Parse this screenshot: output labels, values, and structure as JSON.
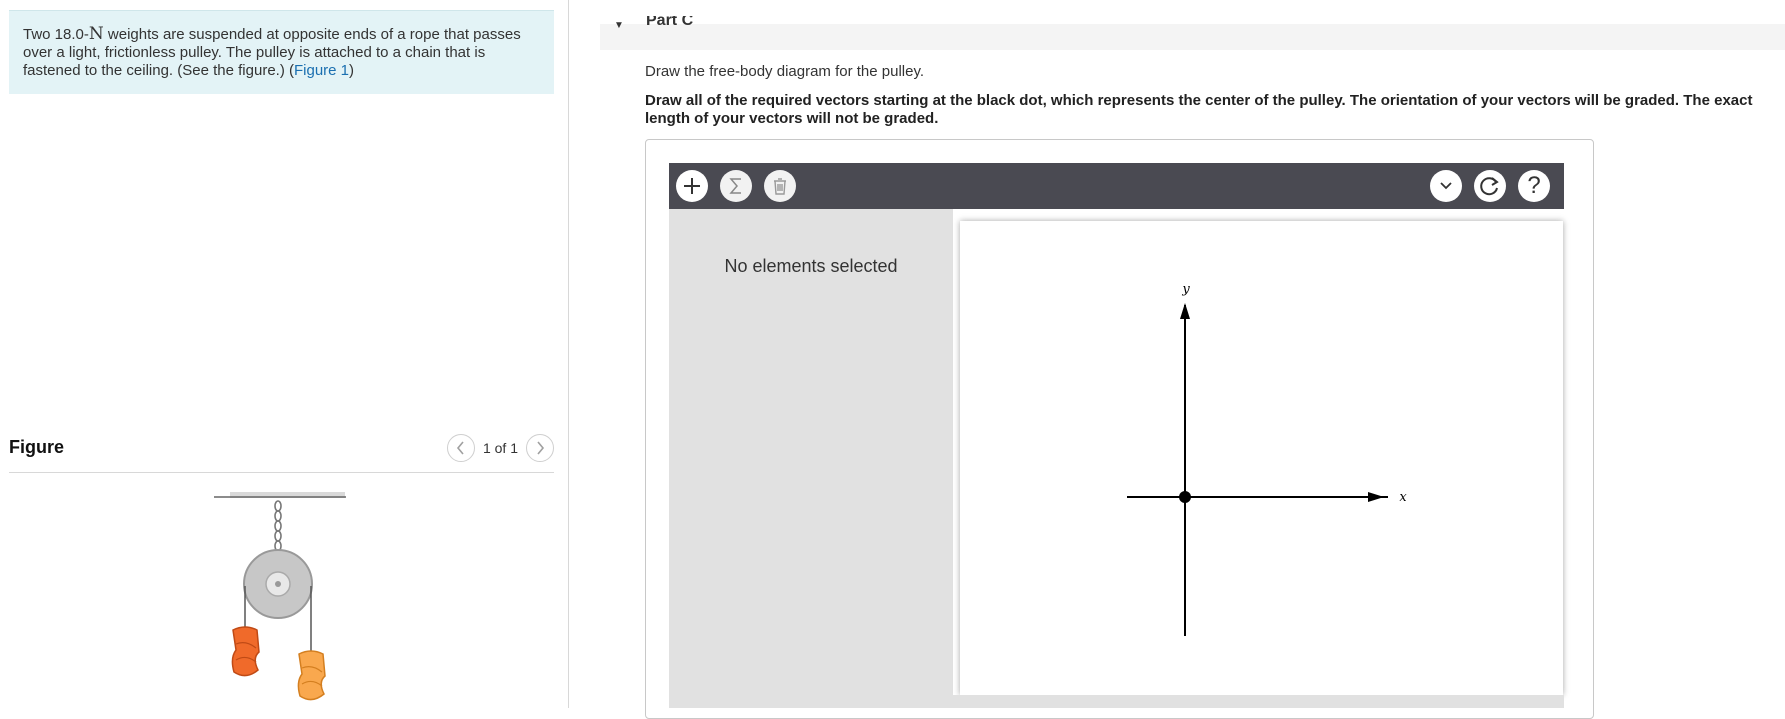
{
  "problem": {
    "text_before": "Two 18.0-",
    "unit_symbol": "N",
    "text_after": " weights are suspended at opposite ends of a rope that passes over a light, frictionless pulley. The pulley is attached to a chain that is fastened to the ceiling. (See the figure.) (",
    "figure_link": "Figure 1",
    "text_end": ")"
  },
  "figure": {
    "title": "Figure",
    "pager_text": "1 of 1",
    "prev_icon": "chevron-left-icon",
    "next_icon": "chevron-right-icon"
  },
  "part": {
    "label": "Part C",
    "toggle_icon": "caret-down-icon"
  },
  "instructions": {
    "line1": "Draw the free-body diagram for the pulley.",
    "line2": "Draw all of the required vectors starting at the black dot, which represents the center of the pulley. The orientation of your vectors will be graded. The exact length of your vectors will not be graded."
  },
  "toolbar": {
    "add_icon": "plus-icon",
    "sum_icon": "sigma-icon",
    "delete_icon": "trash-icon",
    "dropdown_icon": "chevron-down-icon",
    "reset_icon": "reset-icon",
    "help_label": "?"
  },
  "side_panel": {
    "message": "No elements selected"
  },
  "canvas": {
    "x_label": "x",
    "y_label": "y"
  },
  "colors": {
    "problem_bg": "#e3f3f6",
    "link": "#1a6fb0",
    "toolbar_bg": "#4a4a52",
    "panel_bg": "#e1e1e1"
  }
}
